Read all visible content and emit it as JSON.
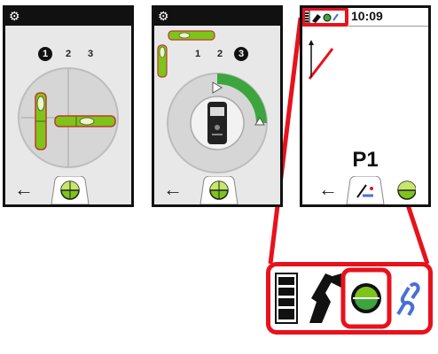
{
  "colors": {
    "highlight": "#e8111c",
    "vial": "#7ec41a",
    "bubble_outline": "#c0392b",
    "screen_frame": "#111111"
  },
  "screen1": {
    "gear_icon": "⚙",
    "steps": [
      "1",
      "2",
      "3"
    ],
    "active_step": "1",
    "back_icon": "←"
  },
  "screen2": {
    "gear_icon": "⚙",
    "steps": [
      "1",
      "2",
      "3"
    ],
    "active_step": "3",
    "back_icon": "←"
  },
  "screen3": {
    "time": "10:09",
    "point_label": "P1",
    "back_icon": "←"
  },
  "zoom_icons": [
    "battery-icon",
    "tripod-adapter-icon",
    "level-sensor-icon",
    "link-icon"
  ]
}
